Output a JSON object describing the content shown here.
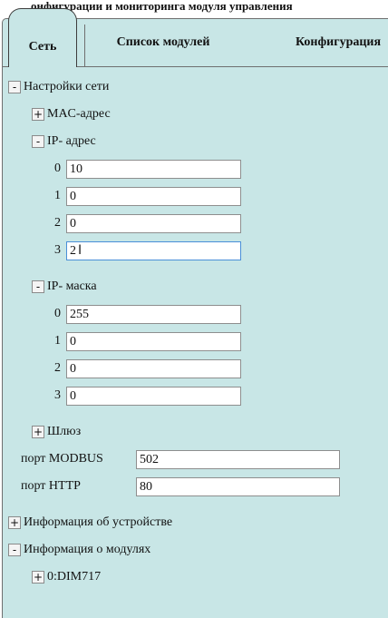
{
  "caption": "онфигурации и мониторинга модуля управления",
  "tabs": [
    {
      "label": "Сеть",
      "active": true
    },
    {
      "label": "Список модулей",
      "active": false
    },
    {
      "label": "Конфигурация",
      "active": false
    }
  ],
  "tree": {
    "network": {
      "toggle": "-",
      "label": "Настройки сети",
      "mac": {
        "toggle": "+",
        "label": "MAC-адрес"
      },
      "ip": {
        "toggle": "-",
        "label": "IP- адрес",
        "octets": [
          {
            "index": "0",
            "value": "10"
          },
          {
            "index": "1",
            "value": "0"
          },
          {
            "index": "2",
            "value": "0"
          },
          {
            "index": "3",
            "value": "2"
          }
        ]
      },
      "mask": {
        "toggle": "-",
        "label": "IP- маска",
        "octets": [
          {
            "index": "0",
            "value": "255"
          },
          {
            "index": "1",
            "value": "0"
          },
          {
            "index": "2",
            "value": "0"
          },
          {
            "index": "3",
            "value": "0"
          }
        ]
      },
      "gateway": {
        "toggle": "+",
        "label": "Шлюз"
      },
      "modbus": {
        "label": "порт MODBUS",
        "value": "502"
      },
      "http": {
        "label": "порт HTTP",
        "value": "80"
      }
    },
    "device_info": {
      "toggle": "+",
      "label": "Информация об устройстве"
    },
    "modules_info": {
      "toggle": "-",
      "label": "Информация о модулях",
      "module": {
        "toggle": "+",
        "label": "0:DIM717"
      }
    }
  }
}
